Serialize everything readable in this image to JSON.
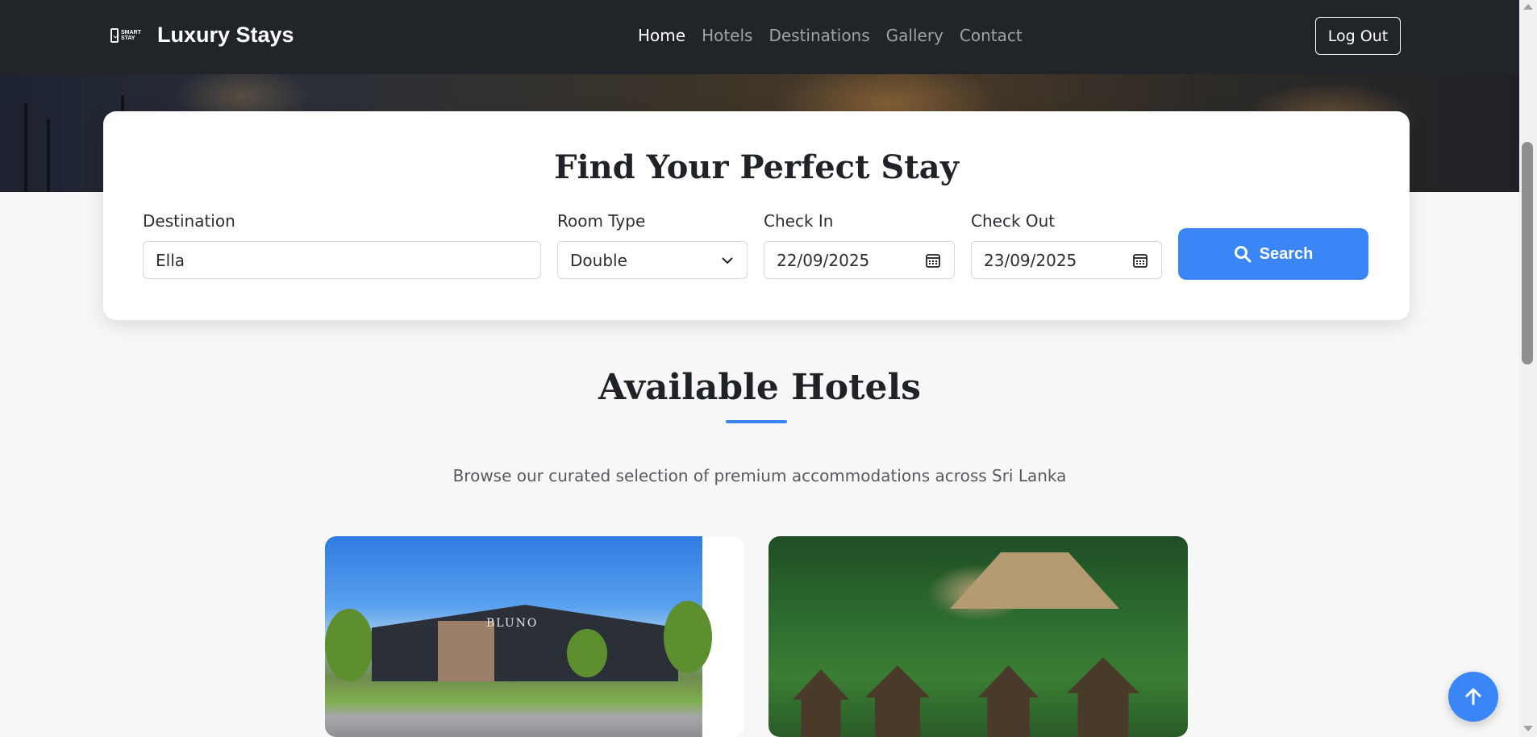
{
  "brand": {
    "logo_text": "SMART STAY",
    "name": "Luxury Stays"
  },
  "nav": {
    "links": [
      "Home",
      "Hotels",
      "Destinations",
      "Gallery",
      "Contact"
    ],
    "active": "Home",
    "logout_label": "Log Out"
  },
  "search": {
    "title": "Find Your Perfect Stay",
    "destination_label": "Destination",
    "destination_value": "Ella",
    "room_type_label": "Room Type",
    "room_type_value": "Double",
    "check_in_label": "Check In",
    "check_in_value": "22/09/2025",
    "check_out_label": "Check Out",
    "check_out_value": "23/09/2025",
    "button_label": "Search"
  },
  "section": {
    "title": "Available Hotels",
    "subtitle": "Browse our curated selection of premium accommodations across Sri Lanka"
  },
  "hotels": [
    {
      "image_sign": "BLUNO"
    },
    {
      "image_sign": ""
    }
  ],
  "colors": {
    "accent": "#3a86f7",
    "navbar": "#212529"
  }
}
